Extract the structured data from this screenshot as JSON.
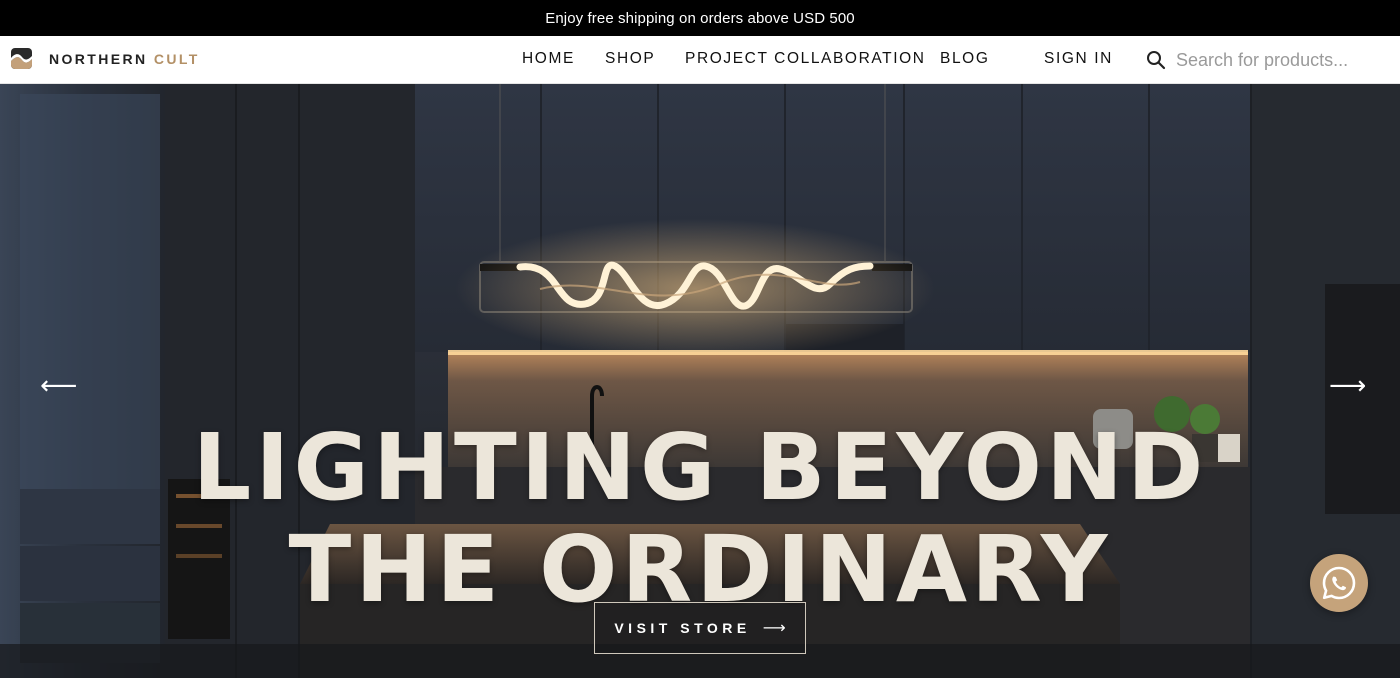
{
  "announcement": {
    "text": "Enjoy free shipping on orders above USD 500"
  },
  "brand": {
    "name_main": "NORTHERN",
    "name_accent": "CULT",
    "accent_color": "#b39066"
  },
  "nav": {
    "items": [
      {
        "label": "HOME"
      },
      {
        "label": "SHOP"
      },
      {
        "label": "PROJECT COLLABORATION"
      },
      {
        "label": "BLOG"
      }
    ],
    "sign_in": "SIGN IN"
  },
  "search": {
    "placeholder": "Search for products...",
    "value": "",
    "icon": "search-icon"
  },
  "hero": {
    "headline_line1": "LIGHTING BEYOND",
    "headline_line2": "THE ORDINARY",
    "cta_label": "VISIT STORE",
    "cta_arrow": "⟶",
    "prev_arrow": "⟵",
    "next_arrow": "⟶",
    "text_color": "#ece6da"
  },
  "whatsapp": {
    "icon": "whatsapp-icon",
    "color": "#c5a37b"
  }
}
